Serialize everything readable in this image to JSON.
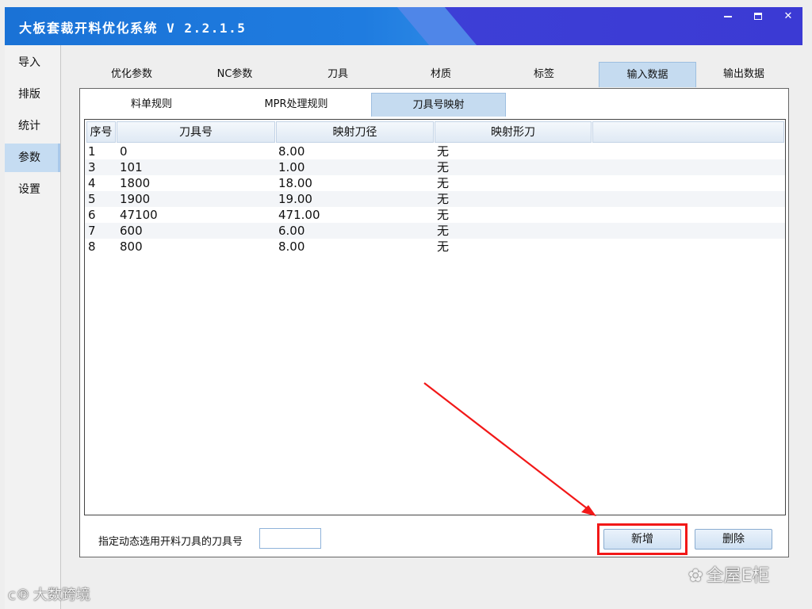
{
  "window": {
    "title": "大板套裁开料优化系统 V 2.2.1.5",
    "controls": {
      "minimize_icon": "minimize-icon",
      "maximize_icon": "maximize-icon",
      "close_label": "✕"
    }
  },
  "sidebar": {
    "items": [
      {
        "label": "导入",
        "active": false
      },
      {
        "label": "排版",
        "active": false
      },
      {
        "label": "统计",
        "active": false
      },
      {
        "label": "参数",
        "active": true
      },
      {
        "label": "设置",
        "active": false
      }
    ]
  },
  "main_tabs": [
    {
      "label": "优化参数",
      "active": false
    },
    {
      "label": "NC参数",
      "active": false
    },
    {
      "label": "刀具",
      "active": false
    },
    {
      "label": "材质",
      "active": false
    },
    {
      "label": "标签",
      "active": false
    },
    {
      "label": "输入数据",
      "active": true
    },
    {
      "label": "输出数据",
      "active": false
    }
  ],
  "sub_tabs": [
    {
      "label": "料单规则",
      "active": false
    },
    {
      "label": "MPR处理规则",
      "active": false
    },
    {
      "label": "刀具号映射",
      "active": true
    }
  ],
  "table": {
    "columns": [
      "序号",
      "刀具号",
      "映射刀径",
      "映射形刀"
    ],
    "rows": [
      [
        "1",
        "0",
        "8.00",
        "无"
      ],
      [
        "3",
        "101",
        "1.00",
        "无"
      ],
      [
        "4",
        "1800",
        "18.00",
        "无"
      ],
      [
        "5",
        "1900",
        "19.00",
        "无"
      ],
      [
        "6",
        "47100",
        "471.00",
        "无"
      ],
      [
        "7",
        "600",
        "6.00",
        "无"
      ],
      [
        "8",
        "800",
        "8.00",
        "无"
      ]
    ]
  },
  "footer": {
    "dynamic_tool_label": "指定动态选用开料刀具的刀具号",
    "dynamic_tool_value": "",
    "add_button": "新增",
    "delete_button": "删除"
  },
  "annotation": {
    "highlight_color": "#f21818"
  },
  "watermarks": {
    "left": "大数跨境",
    "right": "全屋E柜"
  },
  "colors": {
    "titlebar": "#1f7ce0",
    "active_tab": "#c5dbf0",
    "sidebar_active": "#c5dcf2"
  }
}
